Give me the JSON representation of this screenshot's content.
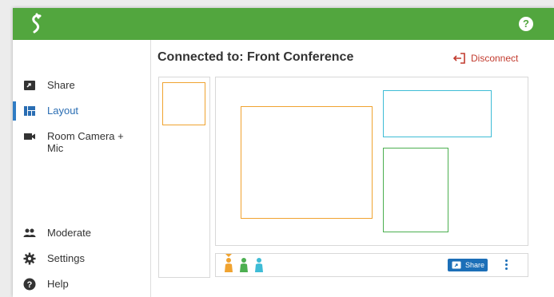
{
  "app": {
    "logo_icon": "s-logo-icon",
    "help_icon": "question-circle-icon",
    "help_glyph": "?",
    "brand_color": "#52a63e"
  },
  "sidebar": {
    "items": [
      {
        "label": "Share",
        "icon": "share-screen-icon",
        "active": false
      },
      {
        "label": "Layout",
        "icon": "layout-icon",
        "active": true
      },
      {
        "label": "Room Camera +\nMic",
        "icon": "video-camera-icon",
        "active": false
      },
      {
        "label": "Moderate",
        "icon": "people-icon",
        "active": false
      },
      {
        "label": "Settings",
        "icon": "gear-icon",
        "active": false
      },
      {
        "label": "Help",
        "icon": "help-icon",
        "active": false
      }
    ]
  },
  "main": {
    "title": "Connected to: Front Conference",
    "disconnect_label": "Disconnect",
    "disconnect_color": "#c23b2e"
  },
  "bottom_bar": {
    "participants": [
      {
        "color": "#f0a330",
        "selected": true
      },
      {
        "color": "#4caf50",
        "selected": false
      },
      {
        "color": "#3ebcd6",
        "selected": false
      }
    ],
    "share_label": "Share",
    "share_color": "#1c6fb8",
    "more_icon": "vertical-dots-icon"
  },
  "colors": {
    "accent": "#2f7cc4",
    "orange": "#f0a330",
    "teal": "#3ebcd6",
    "green": "#4caf50"
  }
}
